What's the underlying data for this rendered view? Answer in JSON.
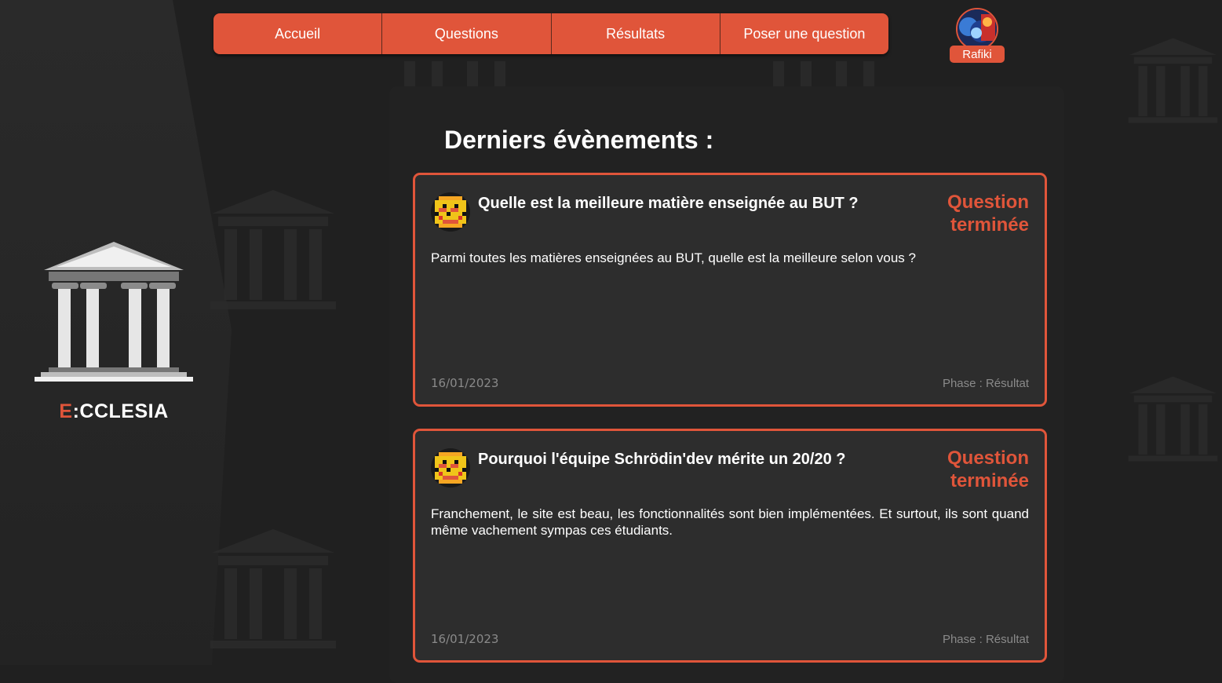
{
  "brand": {
    "accent_letter": "E",
    "rest": ":CCLESIA"
  },
  "nav": {
    "items": [
      {
        "label": "Accueil"
      },
      {
        "label": "Questions"
      },
      {
        "label": "Résultats"
      },
      {
        "label": "Poser une question"
      }
    ]
  },
  "user": {
    "name": "Rafiki"
  },
  "main": {
    "title": "Derniers évènements :",
    "events": [
      {
        "title": "Quelle est la meilleure matière enseignée au BUT ?",
        "status": "Question terminée",
        "description": "Parmi toutes les matières enseignées au BUT, quelle est la meilleure selon vous ?",
        "date": "16/01/2023",
        "phase": "Phase : Résultat"
      },
      {
        "title": "Pourquoi l'équipe Schrödin'dev mérite un 20/20 ?",
        "status": "Question terminée",
        "description": "Franchement, le site est beau, les fonctionnalités sont bien implémentées. Et surtout, ils sont quand même vachement sympas ces étudiants.",
        "date": "16/01/2023",
        "phase": "Phase : Résultat"
      }
    ]
  },
  "colors": {
    "accent": "#e0553a",
    "background": "#202020",
    "card": "#2d2d2d"
  }
}
